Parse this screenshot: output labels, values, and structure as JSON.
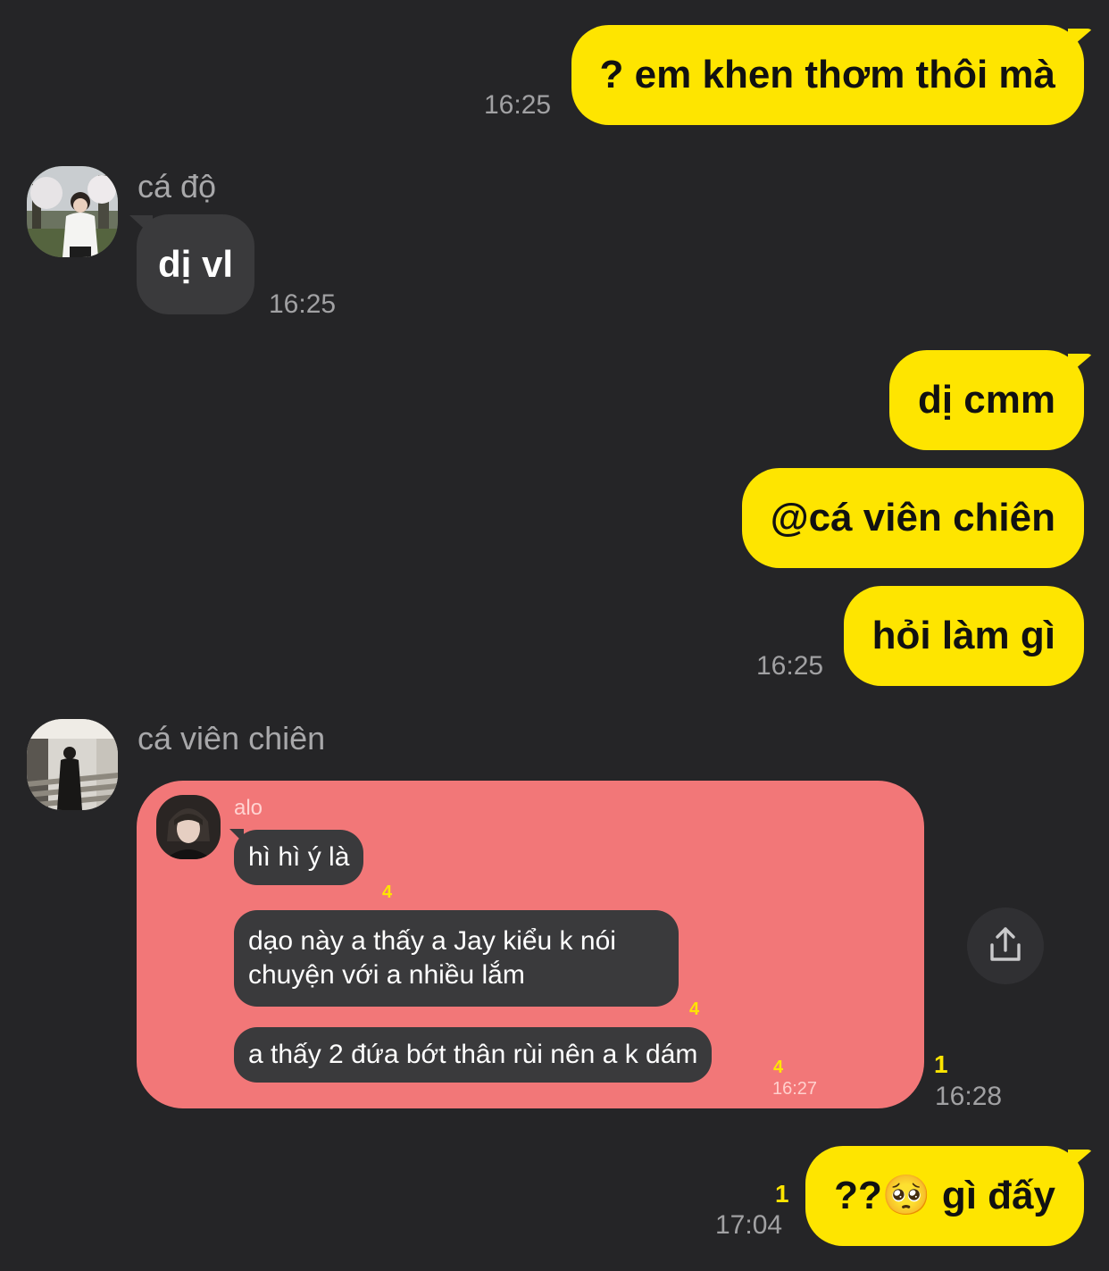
{
  "messages": {
    "m1": {
      "text": "? em khen thơm thôi mà",
      "time": "16:25"
    },
    "m2": {
      "sender": "cá độ",
      "text": "dị vl",
      "time": "16:25"
    },
    "m3": {
      "text": "dị cmm"
    },
    "m4": {
      "text": "@cá viên chiên"
    },
    "m5": {
      "text": "hỏi làm gì",
      "time": "16:25"
    },
    "m6": {
      "sender": "cá viên chiên",
      "unread": "1",
      "time": "16:28",
      "shared": {
        "name": "alo",
        "lines": [
          {
            "text": "hì hì ý là",
            "count": "4"
          },
          {
            "text": "dạo này a thấy a Jay kiểu k nói chuyện với a nhiều lắm",
            "count": "4"
          },
          {
            "text": "a thấy 2 đứa bớt thân rùi nên a k dám",
            "count": "4",
            "time": "16:27"
          }
        ]
      }
    },
    "m7": {
      "text_prefix": "??",
      "emoji": "🥺",
      "text_suffix": " gì đấy",
      "unread": "1",
      "time": "17:04"
    }
  },
  "colors": {
    "background": "#252527",
    "outgoing_bubble": "#fee500",
    "incoming_bubble": "#3a3a3c",
    "shared_card": "#f27778",
    "unread": "#fee500"
  },
  "icons": {
    "share": "share-upload-icon"
  }
}
